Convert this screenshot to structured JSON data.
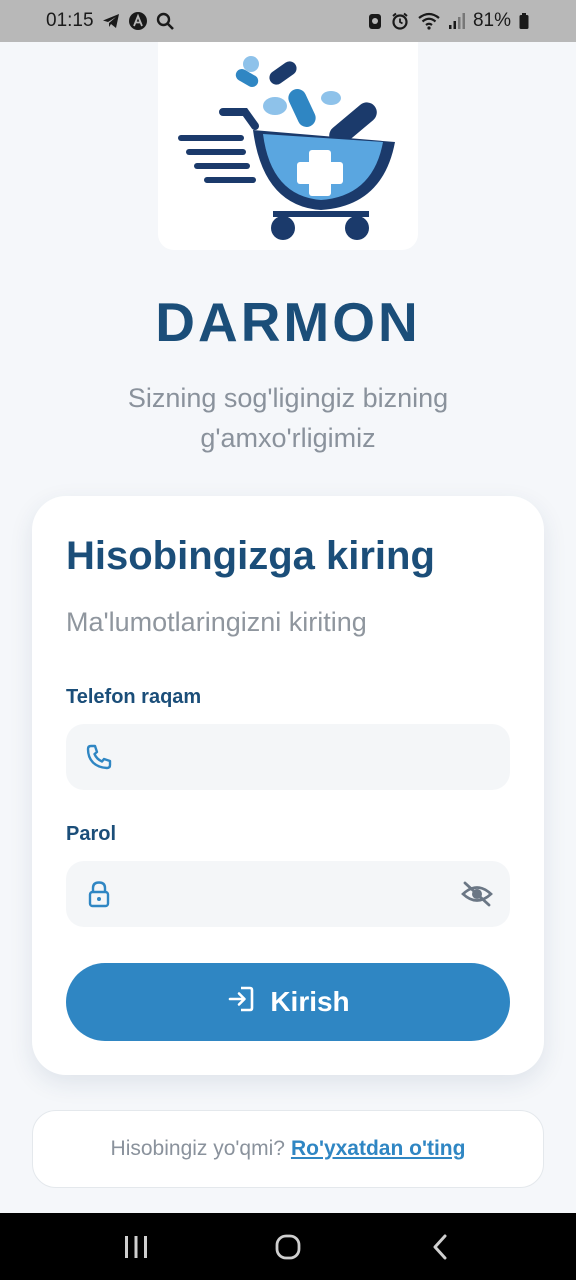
{
  "status_bar": {
    "time": "01:15",
    "battery": "81%",
    "left_icons": [
      "telegram-icon",
      "app-a-icon",
      "search-icon"
    ],
    "right_icons": [
      "notification-icon",
      "alarm-icon",
      "wifi-icon",
      "signal-icon",
      "battery-icon"
    ]
  },
  "header": {
    "app_name": "DARMON",
    "tagline_line1": "Sizning sog'ligingiz bizning",
    "tagline_line2": "g'amxo'rligimiz"
  },
  "login_card": {
    "title": "Hisobingizga kiring",
    "subtitle": "Ma'lumotlaringizni kiriting",
    "phone": {
      "label": "Telefon raqam",
      "value": "",
      "placeholder": "",
      "icon": "phone-icon"
    },
    "password": {
      "label": "Parol",
      "value": "",
      "placeholder": "",
      "icon": "lock-icon",
      "toggle_icon": "eye-off-icon"
    },
    "submit_label": "Kirish",
    "submit_icon": "login-icon"
  },
  "register": {
    "prompt": "Hisobingiz yo'qmi?",
    "link": "Ro'yxatdan o'ting"
  },
  "colors": {
    "primary_dark": "#1b4e79",
    "primary": "#2f86c3",
    "muted_text": "#8a929c",
    "background": "#f5f7fa",
    "input_bg": "#f4f6f8"
  }
}
